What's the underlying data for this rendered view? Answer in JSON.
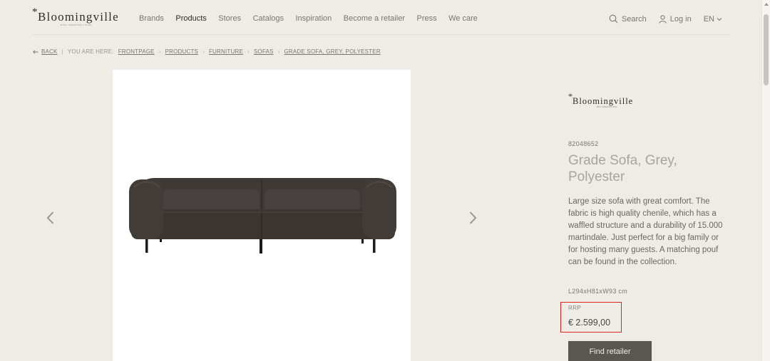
{
  "header": {
    "logo_text": "Bloomingville",
    "logo_star": "*",
    "logo_tagline": "EASY CREATIVE LIVING",
    "nav": [
      "Brands",
      "Products",
      "Stores",
      "Catalogs",
      "Inspiration",
      "Become a retailer",
      "Press",
      "We care"
    ],
    "active_nav": "Products",
    "search_label": "Search",
    "login_label": "Log in",
    "lang_label": "EN"
  },
  "breadcrumb": {
    "back_label": "BACK",
    "prefix": "YOU ARE HERE:",
    "items": [
      "FRONTPAGE",
      "PRODUCTS",
      "FURNITURE",
      "SOFAS",
      "GRADE SOFA, GREY, POLYESTER"
    ]
  },
  "product": {
    "brand": "Bloomingville",
    "brand_star": "*",
    "brand_tagline": "EASY CREATIVE LIVING",
    "sku": "82048652",
    "title": "Grade Sofa, Grey, Polyester",
    "description": "Large size sofa with great comfort. The fabric is high quality chenile, which has a waffled structure and a durability of 15.000 martindale. Just perfect for a big family or for hosting many guests. A matching pouf can be found in the collection.",
    "dimensions": "L294xH81xW93 cm",
    "rrp_label": "RRP",
    "price": "€ 2.599,00",
    "cta_label": "Find retailer",
    "image_alt": "Grade Sofa, Grey, Polyester"
  },
  "colors": {
    "background": "#efece7",
    "gallery_bg": "#ffffff",
    "sofa": "#3d3734",
    "button": "#5a5651",
    "highlight_box": "#e0261c"
  },
  "icons": {
    "search": "search-icon",
    "user": "user-icon",
    "chevron": "chevron-down-icon",
    "back": "arrow-left-icon",
    "prev": "chevron-left-icon",
    "next": "chevron-right-icon"
  }
}
